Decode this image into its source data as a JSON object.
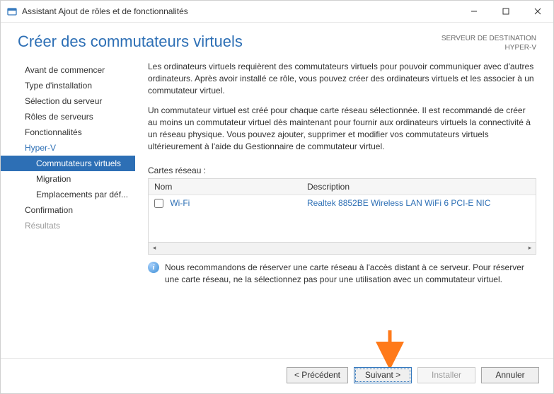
{
  "window": {
    "title": "Assistant Ajout de rôles et de fonctionnalités"
  },
  "header": {
    "heading": "Créer des commutateurs virtuels",
    "dest_label": "SERVEUR DE DESTINATION",
    "dest_name": "HYPER-V"
  },
  "sidebar": {
    "items": [
      {
        "label": "Avant de commencer"
      },
      {
        "label": "Type d'installation"
      },
      {
        "label": "Sélection du serveur"
      },
      {
        "label": "Rôles de serveurs"
      },
      {
        "label": "Fonctionnalités"
      },
      {
        "label": "Hyper-V"
      },
      {
        "label": "Commutateurs virtuels"
      },
      {
        "label": "Migration"
      },
      {
        "label": "Emplacements par déf..."
      },
      {
        "label": "Confirmation"
      },
      {
        "label": "Résultats"
      }
    ]
  },
  "content": {
    "para1": "Les ordinateurs virtuels requièrent des commutateurs virtuels pour pouvoir communiquer avec d'autres ordinateurs. Après avoir installé ce rôle, vous pouvez créer des ordinateurs virtuels et les associer à un commutateur virtuel.",
    "para2": "Un commutateur virtuel est créé pour chaque carte réseau sélectionnée. Il est recommandé de créer au moins un commutateur virtuel dès maintenant pour fournir aux ordinateurs virtuels la connectivité à un réseau physique. Vous pouvez ajouter, supprimer et modifier vos commutateurs virtuels ultérieurement à l'aide du Gestionnaire de commutateur virtuel.",
    "table_label": "Cartes réseau :",
    "col_name": "Nom",
    "col_desc": "Description",
    "rows": [
      {
        "name": "Wi-Fi",
        "desc": "Realtek 8852BE Wireless LAN WiFi 6 PCI-E NIC"
      }
    ],
    "info": "Nous recommandons de réserver une carte réseau à l'accès distant à ce serveur. Pour réserver une carte réseau, ne la sélectionnez pas pour une utilisation avec un commutateur virtuel."
  },
  "footer": {
    "prev": "< Précédent",
    "next": "Suivant >",
    "install": "Installer",
    "cancel": "Annuler"
  }
}
